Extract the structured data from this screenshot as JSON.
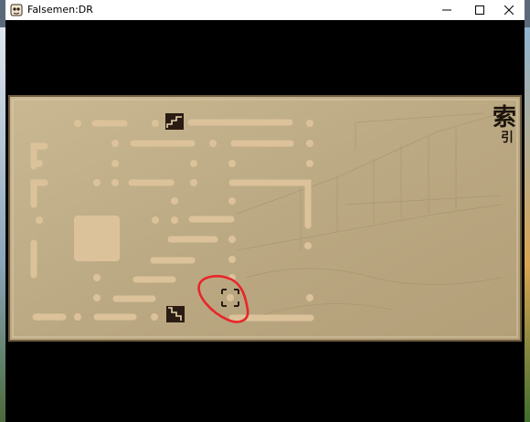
{
  "window": {
    "title": "Falsemen:DR",
    "minimize_label": "minimize",
    "maximize_label": "maximize",
    "close_label": "close"
  },
  "map": {
    "heading_kanji": "索",
    "subheading_kanji": "引",
    "stairs_up_icon": "stairs-up-icon",
    "stairs_down_icon": "stairs-down-icon",
    "player_marker_icon": "player-position-marker-icon",
    "annotation": "red-circle-annotation",
    "colors": {
      "parchment": "#c2b089",
      "frame": "#6b5a3e",
      "corridor": "#dcc29a",
      "annotation": "#e8262a",
      "stairs": "#2a1c12"
    }
  }
}
